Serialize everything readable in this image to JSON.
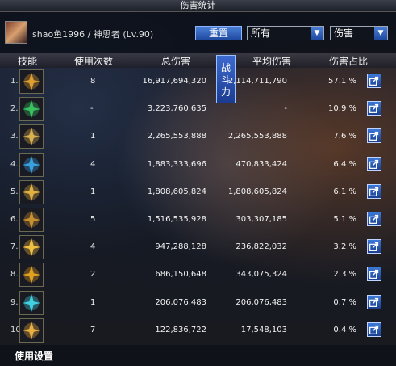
{
  "window": {
    "title": "伤害统计"
  },
  "header": {
    "character": "shao鱼1996 / 神思者 (Lv.90)",
    "reset_label": "重置",
    "filter_target": "所有",
    "filter_type": "伤害"
  },
  "columns": {
    "skill": "技能",
    "count": "使用次数",
    "total": "总伤害",
    "avg": "平均伤害",
    "pct": "伤害占比"
  },
  "combat_label": "战斗力",
  "rows": [
    {
      "idx": "1.",
      "icon": "lightning-burst-icon",
      "color": "#e0a030",
      "count": "8",
      "total": "16,917,694,320",
      "avg": "2,114,711,790",
      "pct": "57.1 %"
    },
    {
      "idx": "2.",
      "icon": "green-spark-icon",
      "color": "#3ac060",
      "count": "-",
      "total": "3,223,760,635",
      "avg": "-",
      "pct": "10.9 %"
    },
    {
      "idx": "3.",
      "icon": "winged-strike-icon",
      "color": "#d8b050",
      "count": "1",
      "total": "2,265,553,888",
      "avg": "2,265,553,888",
      "pct": "7.6 %"
    },
    {
      "idx": "4.",
      "icon": "blue-pillar-icon",
      "color": "#3aa0e0",
      "count": "4",
      "total": "1,883,333,696",
      "avg": "470,833,424",
      "pct": "6.4 %"
    },
    {
      "idx": "5.",
      "icon": "golden-wheel-icon",
      "color": "#e0b040",
      "count": "1",
      "total": "1,808,605,824",
      "avg": "1,808,605,824",
      "pct": "6.1 %"
    },
    {
      "idx": "6.",
      "icon": "golden-mech-icon",
      "color": "#c89030",
      "count": "5",
      "total": "1,516,535,928",
      "avg": "303,307,185",
      "pct": "5.1 %"
    },
    {
      "idx": "7.",
      "icon": "radiant-cross-icon",
      "color": "#f0c040",
      "count": "4",
      "total": "947,288,128",
      "avg": "236,822,032",
      "pct": "3.2 %"
    },
    {
      "idx": "8.",
      "icon": "golden-pillar-icon",
      "color": "#e0a020",
      "count": "2",
      "total": "686,150,648",
      "avg": "343,075,324",
      "pct": "2.3 %"
    },
    {
      "idx": "9.",
      "icon": "cyan-slash-icon",
      "color": "#40d0e0",
      "count": "1",
      "total": "206,076,483",
      "avg": "206,076,483",
      "pct": "0.7 %"
    },
    {
      "idx": "10.",
      "icon": "golden-sword-icon",
      "color": "#e8b040",
      "count": "7",
      "total": "122,836,722",
      "avg": "17,548,103",
      "pct": "0.4 %"
    }
  ],
  "footer": {
    "settings_label": "使用设置"
  }
}
